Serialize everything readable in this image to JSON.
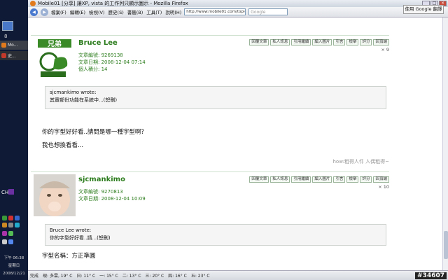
{
  "window": {
    "title": "Mobile01 [分享] 讓XP, vista 的工作列只顯示圖示 - Mozilla Firefox",
    "controls": [
      "_",
      "□",
      "×"
    ]
  },
  "menu": [
    "檔案(F)",
    "編輯(E)",
    "檢視(V)",
    "歷史(S)",
    "書籤(B)",
    "工具(T)",
    "說明(H)"
  ],
  "address_bar": {
    "value": "http://www.mobile01.com/topicde"
  },
  "search_box": {
    "placeholder": "Google"
  },
  "translate_button": "使用 Google 翻譯",
  "posts": [
    {
      "username": "Bruce Lee",
      "article_id": "文章編號: 9269138",
      "date": "文章日期: 2008-12-04 07:14",
      "points": "個人積分: 14",
      "actions": [
        "回覆文章",
        "私人訊息",
        "引用繼續",
        "編入圖片",
        "引言",
        "檢舉",
        "評分",
        "回頂端"
      ],
      "floor": "× 9",
      "quote_author": "sjcmankimo wrote:",
      "quote_text": "其實部份功能在系統中...(恕刪)",
      "lines": [
        "你的字型好好看..請問是哪一種字型啊?",
        "我也想換看看..."
      ],
      "signature": "how:粗得人件 人偶粗得~"
    },
    {
      "username": "sjcmankimo",
      "article_id": "文章編號: 9270813",
      "date": "文章日期: 2008-12-04 10:09",
      "actions": [
        "回覆文章",
        "私人訊息",
        "引用繼續",
        "編入圖片",
        "引言",
        "檢舉",
        "評分",
        "回頂端"
      ],
      "floor": "× 10",
      "quote_author": "Bruce Lee wrote:",
      "quote_text": "你的字型好好看..請...(恕刪)",
      "lines": [
        "字型名稱：方正準圓"
      ]
    }
  ],
  "status": {
    "text": "完成",
    "weather": [
      "現: 多雲, 19° C",
      "日: 11° C",
      "一: 15° C",
      "二: 13° C",
      "三: 20° C",
      "四: 16° C",
      "五: 23° C"
    ],
    "badge": "#34607"
  },
  "desktop": {
    "num": "8",
    "tasks": [
      "Mo...",
      "史..."
    ],
    "ch": "CH",
    "clock": [
      "下午 06:38",
      "星期日",
      "2008/12/21"
    ]
  }
}
